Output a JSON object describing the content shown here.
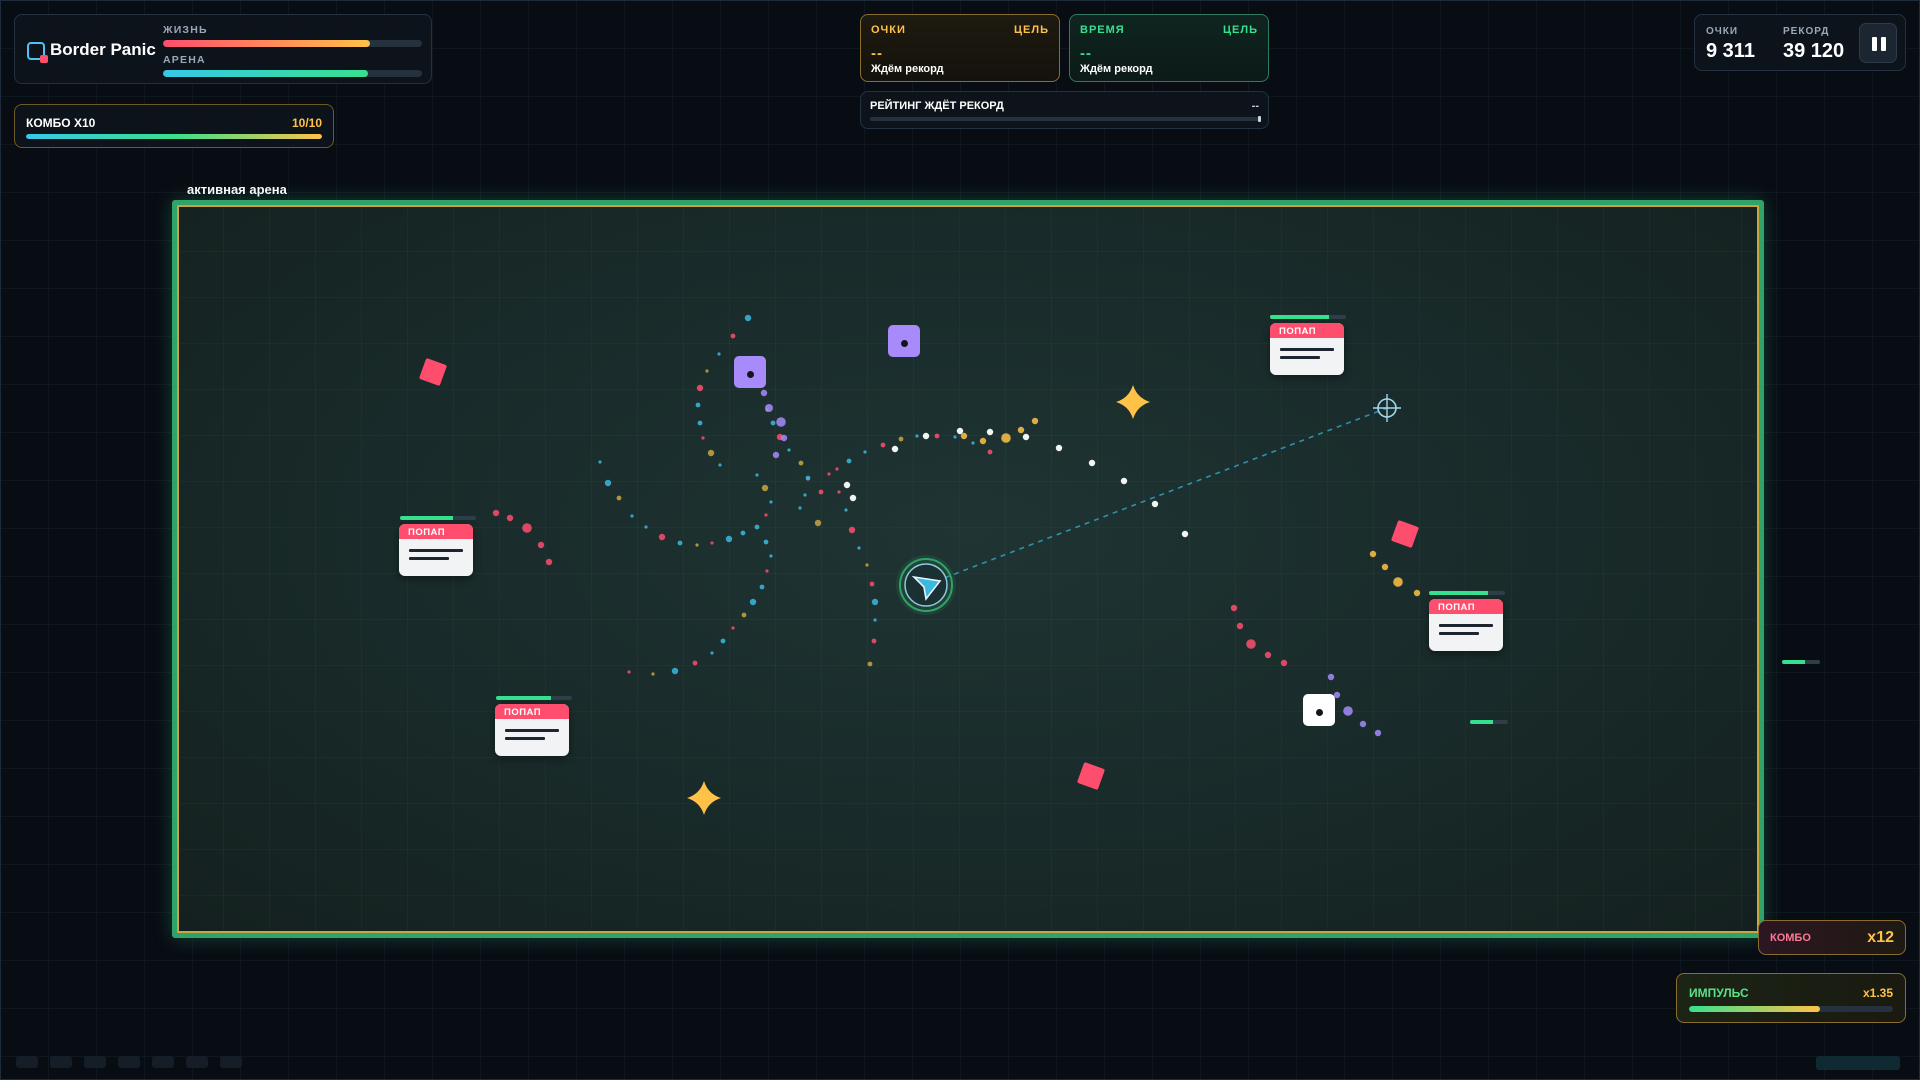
{
  "brand": {
    "name": "Border Panic"
  },
  "stats": {
    "life": {
      "label": "ЖИЗНЬ",
      "fraction": 0.8
    },
    "arena": {
      "label": "АРЕНА",
      "fraction": 0.79
    }
  },
  "combo_goal": {
    "title": "КОМБО X10",
    "count": "10/10",
    "fraction": 1.0
  },
  "score_card": {
    "label": "ОЧКИ",
    "target": "ЦЕЛЬ",
    "value": "--",
    "status": "Ждём рекорд",
    "accent": "#ffc247"
  },
  "time_card": {
    "label": "ВРЕМЯ",
    "target": "ЦЕЛЬ",
    "value": "--",
    "status": "Ждём рекорд",
    "accent": "#37e08e"
  },
  "rating": {
    "title": "РЕЙТИНГ ЖДЁТ РЕКОРД",
    "value": "--",
    "fraction": 0.0
  },
  "score_panel": {
    "score_label": "ОЧКИ",
    "score": "9 311",
    "record_label": "РЕКОРД",
    "record": "39 120"
  },
  "arena": {
    "caption": "активная арена"
  },
  "popups": [
    {
      "title": "ПОПАП",
      "hp": 0.7
    },
    {
      "title": "ПОПАП",
      "hp": 0.73
    },
    {
      "title": "ПОПАП",
      "hp": 0.78
    },
    {
      "title": "ПОПАП",
      "hp": 0.78
    }
  ],
  "combo": {
    "label": "КОМБО",
    "multiplier": "x12"
  },
  "impulse": {
    "label": "ИМПУЛЬС",
    "multiplier": "x1.35",
    "fraction": 0.64
  },
  "colors": {
    "life_start": "#ff4d6d",
    "life_end": "#ffc247",
    "arena_start": "#37c8e8",
    "arena_end": "#37e08e",
    "arena_border": "#2fa36a",
    "danger": "#ff4d6d",
    "gold": "#ffc247",
    "violet": "#a78bfa",
    "cyan": "#39b8e0"
  },
  "icons": {
    "pause": "pause-icon",
    "logo": "brand-logo-icon",
    "player": "player-ship-icon",
    "crosshair": "crosshair-icon",
    "star": "star-pickup-icon",
    "cube": "cube-enemy-icon"
  }
}
